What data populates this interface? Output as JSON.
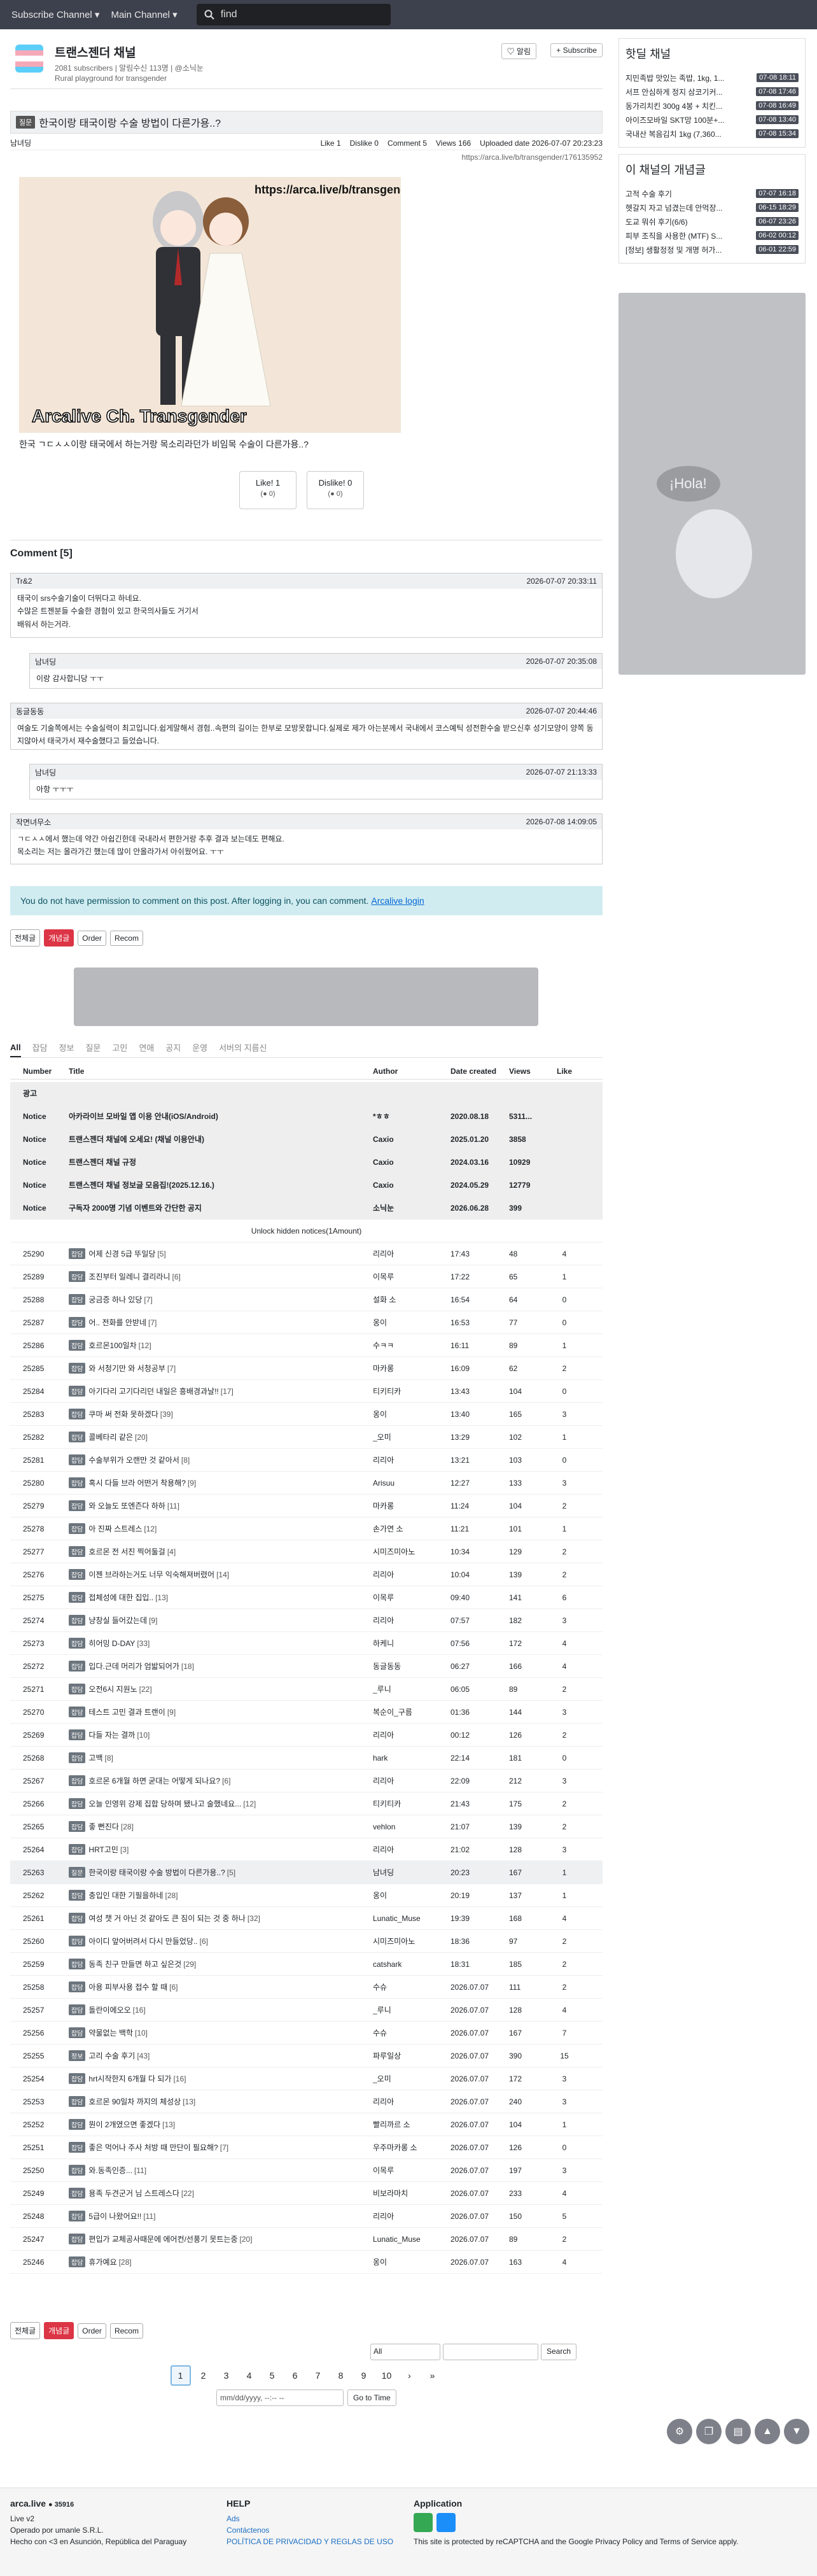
{
  "topbar": {
    "subscribe": "Subscribe Channel ▾",
    "main": "Main Channel ▾",
    "search_placeholder": "find"
  },
  "channel": {
    "name": "트랜스젠더 채널",
    "info": "2081 subscribers | 알림수신 113명 | @소닉눈",
    "desc": "Rural playground for transgender",
    "alert_btn": "♡ 알림",
    "sub_btn": "+ Subscribe"
  },
  "post": {
    "category": "질문",
    "title": "한국이랑 태국이랑 수술 방법이 다른가용..?",
    "author": "남녀딩",
    "like": "Like 1",
    "dislike": "Dislike 0",
    "comment": "Comment 5",
    "views": "Views 166",
    "uploaded": "Uploaded date 2026-07-07 20:23:23",
    "url": "https://arca.live/b/transgender/176135952",
    "body": "한국 ㄱㄷㅅㅅ이랑 태국에서 하는거랑 목소리라던가 비임목 수술이 다른가용..?",
    "like_btn": "Like! 1",
    "like_sub": "(● 0)",
    "dislike_btn": "Dislike! 0",
    "dislike_sub": "(● 0)",
    "art_caption": "Arcalive Ch. Transgender",
    "art_url": "https://arca.live/b/transgender"
  },
  "comments": {
    "heading": "Comment [5]",
    "items": [
      {
        "user": "Tr&2",
        "date": "2026-07-07 20:33:11",
        "text": "태국이 srs수술기술이 더뛰다고 하네요.\n수많은 트젠분들 수술한 경험이 있고 한국의사들도 거기서\n배워서 하는거라."
      },
      {
        "user": "남녀딩",
        "date": "2026-07-07 20:35:08",
        "text": "이랑 감사합니당 ㅜㅜ"
      },
      {
        "user": "동글동동",
        "date": "2026-07-07 20:44:46",
        "text": "여술도 기술쪽에서는 수술실력이 최고입니다.쉽게말해서 경험..속편의 길이는 한부로 모방못합니다.실제로 제가 아는분께서 국내에서 코스예틱 성전환수술 받으신후 성기모양이 양쪽 동지않아서 태국가서 재수술했다고 들었습니다."
      },
      {
        "user": "남녀딩",
        "date": "2026-07-07 21:13:33",
        "text": "아항 ㅜㅜㅜ"
      },
      {
        "user": "작면녀무소",
        "date": "2026-07-08 14:09:05",
        "text": "ㄱㄷㅅㅅ에서 했는데 약간 아쉽긴한데 국내라서 편한거랑 추후 결과 보는데도 편해요.\n목소리는 저는 올라가긴 했는데 많이 안올라가서 아쉬웠어요. ㅜㅜ"
      }
    ]
  },
  "alert": {
    "text": "You do not have permission to comment on this post. After logging in, you can comment.",
    "link": "Arcalive login"
  },
  "controls": {
    "all": "전체글",
    "best": "개념글",
    "order": "Order",
    "recom": "Recom"
  },
  "tabs": [
    "All",
    "잡담",
    "정보",
    "질문",
    "고민",
    "연애",
    "공지",
    "운영",
    "서버의 지름신"
  ],
  "table": {
    "headers": [
      "Number",
      "Title",
      "Author",
      "Date created",
      "Views",
      "Like"
    ],
    "ad_label": "광고",
    "notices": [
      [
        "Notice",
        "아카라이브 모바일 앱 이용 안내(iOS/Android)",
        "*ㅎㅎ",
        "2020.08.18",
        "5311...",
        ""
      ],
      [
        "Notice",
        "트랜스젠더 채널에 오세요! (채널 이용안내)",
        "Caxio",
        "2025.01.20",
        "3858",
        ""
      ],
      [
        "Notice",
        "트랜스젠더 채널 규정",
        "Caxio",
        "2024.03.16",
        "10929",
        ""
      ],
      [
        "Notice",
        "트랜스젠더 채널 정보글 모음집!(2025.12.16.)",
        "Caxio",
        "2024.05.29",
        "12779",
        ""
      ],
      [
        "Notice",
        "구독자 2000명 기념 이벤트와 간단한 공지",
        "소닉눈",
        "2026.06.28",
        "399",
        ""
      ]
    ],
    "unlock": "Unlock hidden notices(1Amount)",
    "rows": [
      [
        "25290",
        "잡담",
        "어제 신경 5급 뚜일당",
        "5",
        "리리아",
        "17:43",
        "48",
        "4"
      ],
      [
        "25289",
        "잡담",
        "조진부터 일레니 결리라니",
        "6",
        "이목루",
        "17:22",
        "65",
        "1"
      ],
      [
        "25288",
        "잡담",
        "궁금증 하나 있당",
        "7",
        "설화 소",
        "16:54",
        "64",
        "0"
      ],
      [
        "25287",
        "잡담",
        "어.. 전화를 안받네",
        "7",
        "옹이",
        "16:53",
        "77",
        "0"
      ],
      [
        "25286",
        "잡담",
        "호르몬100일차",
        "12",
        "수ㅋㅋ",
        "16:11",
        "89",
        "1"
      ],
      [
        "25285",
        "잡담",
        "와 서청기만 와 서청공부",
        "7",
        "마카롱",
        "16:09",
        "62",
        "2"
      ],
      [
        "25284",
        "잡담",
        "아기다리 고기다리던 내일은 흥배경과날!!",
        "17",
        "티키티카",
        "13:43",
        "104",
        "0"
      ],
      [
        "25283",
        "잡담",
        "쿠마 써 전화 못하겠다",
        "39",
        "옹이",
        "13:40",
        "165",
        "3"
      ],
      [
        "25282",
        "잡담",
        "콜베타리 같은",
        "20",
        "_오미",
        "13:29",
        "102",
        "1"
      ],
      [
        "25281",
        "잡담",
        "수술부위가 오랜만 것 같아서",
        "8",
        "리리아",
        "13:21",
        "103",
        "0"
      ],
      [
        "25280",
        "잡담",
        "혹시 다들 브라 어떤거 착용해?",
        "9",
        "Arisuu",
        "12:27",
        "133",
        "3"
      ],
      [
        "25279",
        "잡담",
        "와 오늘도 또엔즌다 하하",
        "11",
        "마카롱",
        "11:24",
        "104",
        "2"
      ],
      [
        "25278",
        "잡담",
        "아 진짜 스트레스",
        "12",
        "손가연 소",
        "11:21",
        "101",
        "1"
      ],
      [
        "25277",
        "잡담",
        "호르몬 전 서진 찍어둘걸",
        "4",
        "시미즈미아노",
        "10:34",
        "129",
        "2"
      ],
      [
        "25276",
        "잡담",
        "이젠 브라하는거도 너무 익숙해져버렸어",
        "14",
        "리리아",
        "10:04",
        "139",
        "2"
      ],
      [
        "25275",
        "잡담",
        "접체성에 대한 집입..",
        "13",
        "이목루",
        "09:40",
        "141",
        "6"
      ],
      [
        "25274",
        "잡담",
        "냥창실 들어갔는데",
        "9",
        "리리아",
        "07:57",
        "182",
        "3"
      ],
      [
        "25273",
        "잡담",
        "히어밍 D-DAY",
        "33",
        "하케니",
        "07:56",
        "172",
        "4"
      ],
      [
        "25272",
        "잡담",
        "입다.근데 머리가 엄밟되어가",
        "18",
        "동글동동",
        "06:27",
        "166",
        "4"
      ],
      [
        "25271",
        "잡담",
        "오전6시 지원노",
        "22",
        "_루니",
        "06:05",
        "89",
        "2"
      ],
      [
        "25270",
        "잡담",
        "테스트 고민 결과 트랜이",
        "9",
        "복순이_구름",
        "01:36",
        "144",
        "3"
      ],
      [
        "25269",
        "잡담",
        "다들 자는 결까",
        "10",
        "리리아",
        "00:12",
        "126",
        "2"
      ],
      [
        "25268",
        "잡담",
        "고백",
        "8",
        "hark",
        "22:14",
        "181",
        "0"
      ],
      [
        "25267",
        "잡담",
        "호르몬 6개월 하면 굳대는 어떻게 되나요?",
        "6",
        "리리아",
        "22:09",
        "212",
        "3"
      ],
      [
        "25266",
        "잡담",
        "오늘 인영위 강제 집합 당하며 됐나고 술했네요...",
        "12",
        "티키티카",
        "21:43",
        "175",
        "2"
      ],
      [
        "25265",
        "잡담",
        "좋 뻔진다",
        "28",
        "vehlon",
        "21:07",
        "139",
        "2"
      ],
      [
        "25264",
        "잡담",
        "HRT고민",
        "3",
        "리리아",
        "21:02",
        "128",
        "3"
      ],
      [
        "25263",
        "질문",
        "한국이랑 태국이랑 수술 방법이 다른가용..?",
        "5",
        "남녀딩",
        "20:23",
        "167",
        "1"
      ],
      [
        "25262",
        "잡담",
        "충입인 대한 기필을하네",
        "28",
        "옹이",
        "20:19",
        "137",
        "1"
      ],
      [
        "25261",
        "잡담",
        "여성 챗 거 아닌 것 같아도 큰 짐이 되는 것 중 하나",
        "32",
        "Lunatic_Muse",
        "19:39",
        "168",
        "4"
      ],
      [
        "25260",
        "잡담",
        "아이디 앞어버려서 다시 만들었당..",
        "6",
        "시미즈미아노",
        "18:36",
        "97",
        "2"
      ],
      [
        "25259",
        "잡담",
        "동족 친구 만들면 하고 싶은것",
        "29",
        "catshark",
        "18:31",
        "185",
        "2"
      ],
      [
        "25258",
        "잡담",
        "아용 피부사용 접수 할 때",
        "6",
        "수슈",
        "2026.07.07",
        "111",
        "2"
      ],
      [
        "25257",
        "잡담",
        "돌란이에오오",
        "16",
        "_루니",
        "2026.07.07",
        "128",
        "4"
      ],
      [
        "25256",
        "잡담",
        "약물없는 백학",
        "10",
        "수슈",
        "2026.07.07",
        "167",
        "7"
      ],
      [
        "25255",
        "정보",
        "고리 수술 후기",
        "43",
        "파루일상",
        "2026.07.07",
        "390",
        "15"
      ],
      [
        "25254",
        "잡담",
        "hrt시작한지 6개월 다 되가",
        "16",
        "_오미",
        "2026.07.07",
        "172",
        "3"
      ],
      [
        "25253",
        "잡담",
        "호르몬 90일차 까지의 체성상",
        "13",
        "리리아",
        "2026.07.07",
        "240",
        "3"
      ],
      [
        "25252",
        "잡담",
        "뭔이 2개였으면 좋겠다",
        "13",
        "빨리까르 소",
        "2026.07.07",
        "104",
        "1"
      ],
      [
        "25251",
        "잡담",
        "좋은 먹어나 주사 처방 때 만단이 필요해?",
        "7",
        "우주마카롱 소",
        "2026.07.07",
        "126",
        "0"
      ],
      [
        "25250",
        "잡담",
        "와.동족인증...",
        "11",
        "이목루",
        "2026.07.07",
        "197",
        "3"
      ],
      [
        "25249",
        "잡담",
        "용족 두견군거 님 스트레스다",
        "22",
        "비보라마치",
        "2026.07.07",
        "233",
        "4"
      ],
      [
        "25248",
        "잡담",
        "5급이 나왔어요!!",
        "11",
        "리리아",
        "2026.07.07",
        "150",
        "5"
      ],
      [
        "25247",
        "잡담",
        "편입가 교체공사때문에 에어컨/선풍기 못트는중",
        "20",
        "Lunatic_Muse",
        "2026.07.07",
        "89",
        "2"
      ],
      [
        "25246",
        "잡담",
        "휴가예요",
        "28",
        "옹이",
        "2026.07.07",
        "163",
        "4"
      ]
    ]
  },
  "bottom": {
    "select": "All",
    "search_btn": "Search",
    "pages": [
      "1",
      "2",
      "3",
      "4",
      "5",
      "6",
      "7",
      "8",
      "9",
      "10",
      "›",
      "»"
    ],
    "date_placeholder": "mm/dd/yyyy, --:-- --",
    "goto": "Go to Time"
  },
  "sidebar": {
    "hot_title": "핫딜 채널",
    "hot": [
      [
        "지민족밥 맛있는 족밥, 1kg, 1...",
        "07-08 18:11"
      ],
      [
        "서프 안심하게 정지 삼코기커...",
        "07-08 17:46"
      ],
      [
        "동가리치킨 300g 4봉 + 치킨...",
        "07-08 16:49"
      ],
      [
        "아이즈모바일 SKT망 100분+...",
        "07-08 13:40"
      ],
      [
        "국내산 복음김치 1kg (7,360...",
        "07-08 15:34"
      ]
    ],
    "best_title": "이 채널의 개념글",
    "best": [
      [
        "고적 수술 후기",
        "07-07 16:18"
      ],
      [
        "헷갈지 자고 넘겼는데 안먹장...",
        "06-15 18:29"
      ],
      [
        "도교 뭐쉬 후기(6/6)",
        "06-07 23:26"
      ],
      [
        "피부 조직을 사용한 (MTF) S...",
        "06-02 00:12"
      ],
      [
        "[정보] 생활정정 및 개명 허가...",
        "06-01 22:59"
      ]
    ]
  },
  "footer": {
    "brand": "arca.live",
    "brand_count": "● 35916",
    "ver": "Live v2",
    "op": "Operado por umanle S.R.L.",
    "made": "Hecho con <3 en Asunción, República del Paraguay",
    "help": "HELP",
    "help_links": [
      "Ads",
      "Contáctenos",
      "POLÍTICA DE PRIVACIDAD Y REGLAS DE USO"
    ],
    "app": "Application",
    "recaptcha": "This site is protected by reCAPTCHA and the Google Privacy Policy and Terms of Service apply."
  }
}
